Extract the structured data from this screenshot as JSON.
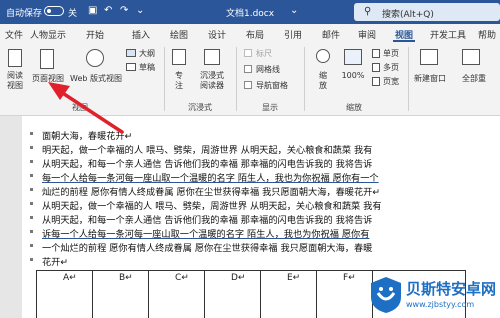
{
  "titlebar": {
    "autosave_label": "自动保存",
    "autosave_state": "关",
    "doc_title": "文档1.docx",
    "search_placeholder": "搜索(Alt+Q)"
  },
  "tabs": [
    {
      "label": "文件"
    },
    {
      "label": "人物显示"
    },
    {
      "label": "开始"
    },
    {
      "label": "插入"
    },
    {
      "label": "绘图"
    },
    {
      "label": "设计"
    },
    {
      "label": "布局"
    },
    {
      "label": "引用"
    },
    {
      "label": "邮件"
    },
    {
      "label": "审阅"
    },
    {
      "label": "视图"
    },
    {
      "label": "开发工具"
    },
    {
      "label": "帮助"
    }
  ],
  "active_tab": "视图",
  "ribbon": {
    "read_view": "阅读\n视图",
    "page_view": "页面视图",
    "web_view": "Web 版式视图",
    "outline": "大纲",
    "draft": "草稿",
    "views_group": "视图",
    "focus": "专\n注",
    "immersive_reader": "沉浸式\n阅读器",
    "immersive_group": "沉浸式",
    "ruler": "标尺",
    "gridlines": "网格线",
    "nav_pane": "导航窗格",
    "show_group": "显示",
    "zoom": "缩\n放",
    "zoom_100": "100%",
    "one_page": "单页",
    "multi_page": "多页",
    "page_width": "页宽",
    "zoom_group": "缩放",
    "new_window": "新建窗口",
    "arrange_all": "全部重"
  },
  "document": {
    "lines": [
      "面朝大海，春暖花开↵",
      "明天起，做一个幸福的人 喂马、劈柴，周游世界 从明天起，关心粮食和蔬菜 我有",
      "从明天起，和每一个亲人通信 告诉他们我的幸福 那幸福的闪电告诉我的 我将告诉",
      "每一个人给每一条河每一座山取一个温暖的名字 陌生人，我也为你祝福 愿你有一个",
      "灿烂的前程 愿你有情人终成眷属 愿你在尘世获得幸福 我只愿面朝大海，春暖花开↵",
      "从明天起，做一个幸福的人 喂马、劈柴，周游世界 从明天起，关心粮食和蔬菜 我有",
      "从明天起，和每一个亲人通信 告诉他们我的幸福 那幸福的闪电告诉我的 我将告诉",
      "诉每一个人给每一条河每一座山取一个温暖的名字 陌生人，我也为你祝福 愿你有",
      "一个灿烂的前程 愿你有情人终成眷属 愿你在尘世获得幸福 我只愿面朝大海，春暖",
      "花开↵"
    ],
    "table_headers": [
      "A↵",
      "B↵",
      "C↵",
      "D↵",
      "E↵",
      "F↵"
    ]
  },
  "watermark": {
    "line1": "贝斯特安卓网",
    "line2": "www.zjbstyy.com"
  },
  "colors": {
    "title_bar": "#2b579a",
    "arrow": "#e0202a",
    "watermark": "#1d6fc4"
  }
}
